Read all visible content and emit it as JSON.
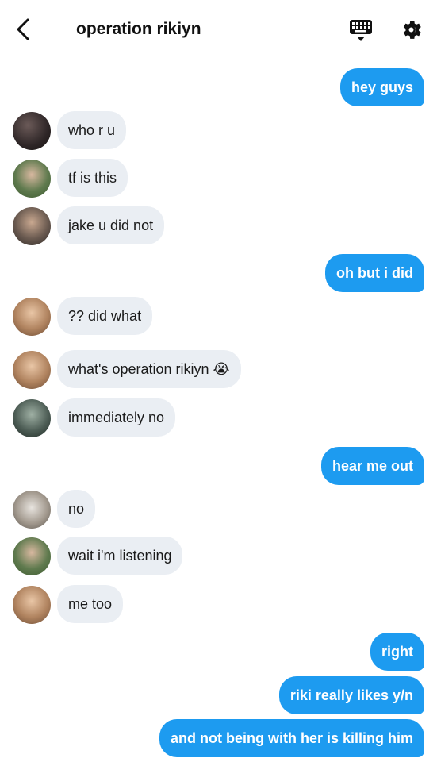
{
  "header": {
    "title": "operation rikiyn",
    "back_icon": "chevron-left-icon",
    "keyboard_icon": "keyboard-icon",
    "settings_icon": "gear-icon"
  },
  "colors": {
    "outgoing": "#1d9bf0",
    "incoming": "#eaeef3"
  },
  "messages": [
    {
      "text": "hey guys",
      "side": "out"
    },
    {
      "text": "who r u",
      "side": "in"
    },
    {
      "text": "tf is this",
      "side": "in"
    },
    {
      "text": "jake u did not",
      "side": "in"
    },
    {
      "text": "oh but i did",
      "side": "out"
    },
    {
      "text": "?? did what",
      "side": "in"
    },
    {
      "text": "what's operation rikiyn 😭",
      "side": "in"
    },
    {
      "text": "immediately no",
      "side": "in"
    },
    {
      "text": "hear me out",
      "side": "out"
    },
    {
      "text": "no",
      "side": "in"
    },
    {
      "text": "wait i'm listening",
      "side": "in"
    },
    {
      "text": "me too",
      "side": "in"
    },
    {
      "text": "right",
      "side": "out"
    },
    {
      "text": "riki really likes y/n",
      "side": "out"
    },
    {
      "text": "and not being with her is killing him",
      "side": "out"
    }
  ]
}
